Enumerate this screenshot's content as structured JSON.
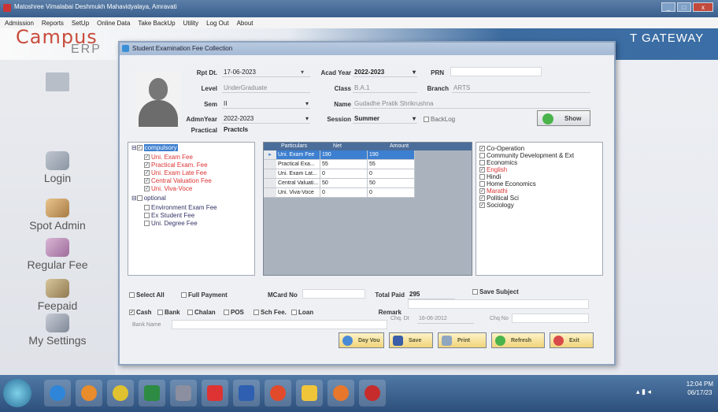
{
  "window": {
    "title": "Matoshree Vimalabai Deshmukh Mahavidyalaya, Amravati",
    "controls": [
      "_",
      "□",
      "x"
    ]
  },
  "menu": [
    "Admission",
    "Reports",
    "SetUp",
    "Online Data",
    "Take BackUp",
    "Utility",
    "Log Out",
    "About"
  ],
  "brand": {
    "line1": "Campus",
    "line2": "ERP",
    "right_text": "T GATEWAY"
  },
  "sidebar": [
    "Login",
    "Spot Admin",
    "Regular Fee",
    "Feepaid",
    "My Settings"
  ],
  "dialog": {
    "title": "Student Examination Fee Collection",
    "fields": {
      "rpt_dt_label": "Rpt Dt.",
      "rpt_dt": "17-06-2023",
      "acad_year_label": "Acad Year",
      "acad_year": "2022-2023",
      "prn_label": "PRN",
      "prn": "",
      "level_label": "Level",
      "level": "UnderGraduate",
      "class_label": "Class",
      "class": "B.A.1",
      "branch_label": "Branch",
      "branch": "ARTS",
      "sem_label": "Sem",
      "sem": "II",
      "name_label": "Name",
      "name": "Gudadhe Pratik Shrikrushna",
      "admn_year_label": "AdmnYear",
      "admn_year": "2022-2023",
      "session_label": "Session",
      "session": "Summer",
      "backlog_label": "BackLog",
      "practical_label": "Practical",
      "practical": "Practcls"
    },
    "show_button": "Show",
    "tree": {
      "compulsory": "compulsory",
      "compulsory_items": [
        "Uni. Exam Fee",
        "Practical Exam. Fee",
        "Uni. Exam Late Fee",
        "Central Valuation Fee",
        "Uni. Viva-Voce"
      ],
      "optional": "optional",
      "optional_items": [
        "Environment Exam Fee",
        "Ex Student Fee",
        "Uni. Degree Fee"
      ]
    },
    "grid": {
      "headers": [
        "Particulars",
        "Net",
        "Amount"
      ],
      "rows": [
        [
          "Uni. Exam Fee",
          "190",
          "190"
        ],
        [
          "Practical Exa...",
          "55",
          "55"
        ],
        [
          "Uni. Exam Lat...",
          "0",
          "0"
        ],
        [
          "Central Valuati...",
          "50",
          "50"
        ],
        [
          "Uni. Viva-Voce",
          "0",
          "0"
        ]
      ]
    },
    "subjects": [
      {
        "name": "Co-Operation",
        "checked": true,
        "color": "#222"
      },
      {
        "name": "Community Development & Ext",
        "checked": false,
        "color": "#222"
      },
      {
        "name": "Economics",
        "checked": false,
        "color": "#222"
      },
      {
        "name": "English",
        "checked": true,
        "color": "#d33"
      },
      {
        "name": "Hindi",
        "checked": false,
        "color": "#222"
      },
      {
        "name": "Home Economics",
        "checked": false,
        "color": "#222"
      },
      {
        "name": "Marathi",
        "checked": true,
        "color": "#d33"
      },
      {
        "name": "Political Sci",
        "checked": true,
        "color": "#222"
      },
      {
        "name": "Sociology",
        "checked": true,
        "color": "#222"
      }
    ],
    "bottom": {
      "select_all": "Select All",
      "full_payment": "Full Payment",
      "mcard_label": "MCard No",
      "total_paid_label": "Total Paid",
      "total_paid": "295",
      "save_subject": "Save Subject",
      "pay_modes": [
        "Cash",
        "Bank",
        "Chalan",
        "POS",
        "Sch Fee.",
        "Loan"
      ],
      "remark_label": "Remark",
      "bank_name_label": "Bank Name",
      "chq_dt_label": "Chq. Dt",
      "chq_dt": "16-06-2012",
      "chq_no_label": "Chq No"
    },
    "buttons": [
      "Day Vou",
      "Save",
      "Print",
      "Refresh",
      "Exit"
    ]
  },
  "taskbar": {
    "time": "12:04 PM",
    "date": "06/17/23"
  }
}
